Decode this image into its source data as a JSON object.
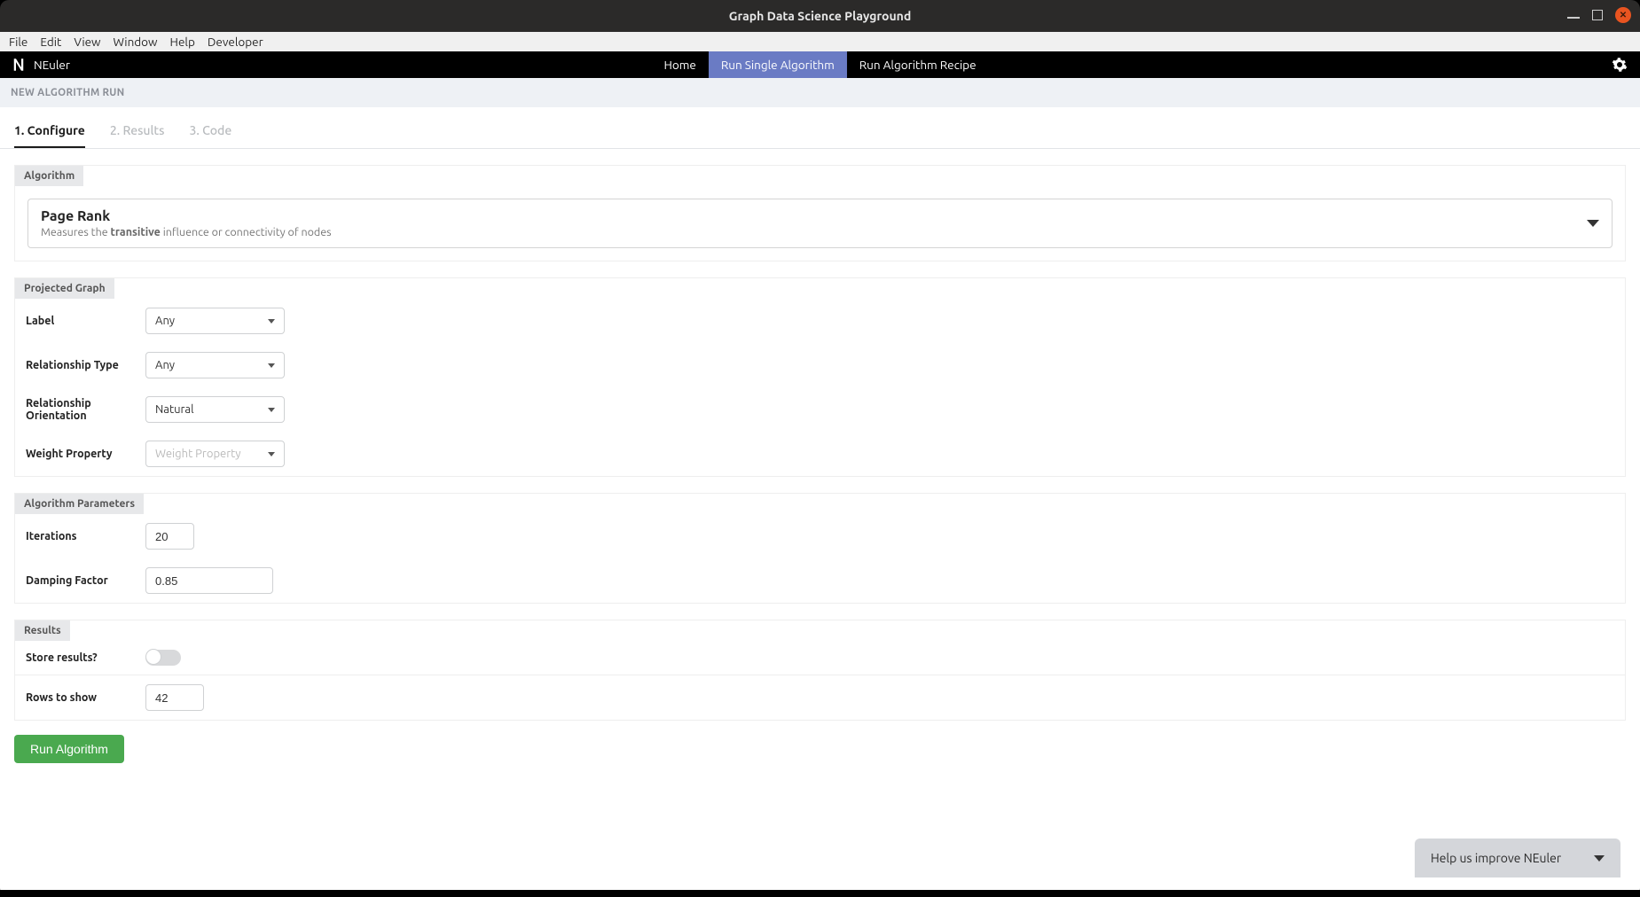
{
  "window": {
    "title": "Graph Data Science Playground"
  },
  "menubar": {
    "items": [
      "File",
      "Edit",
      "View",
      "Window",
      "Help",
      "Developer"
    ]
  },
  "appnav": {
    "brand": "NEuler",
    "items": [
      "Home",
      "Run Single Algorithm",
      "Run Algorithm Recipe"
    ],
    "active_index": 1
  },
  "banner": "NEW ALGORITHM RUN",
  "steps": {
    "items": [
      "1. Configure",
      "2. Results",
      "3. Code"
    ],
    "active_index": 0
  },
  "algorithm_section": {
    "header": "Algorithm",
    "selected": {
      "name": "Page Rank",
      "desc_pre": "Measures the ",
      "desc_strong": "transitive",
      "desc_post": " influence or connectivity of nodes"
    }
  },
  "projected_graph": {
    "header": "Projected Graph",
    "fields": {
      "label": {
        "label": "Label",
        "value": "Any"
      },
      "rel_type": {
        "label": "Relationship Type",
        "value": "Any"
      },
      "rel_orientation": {
        "label": "Relationship Orientation",
        "value": "Natural"
      },
      "weight_property": {
        "label": "Weight Property",
        "placeholder": "Weight Property"
      }
    }
  },
  "algo_params": {
    "header": "Algorithm Parameters",
    "iterations": {
      "label": "Iterations",
      "value": "20"
    },
    "damping": {
      "label": "Damping Factor",
      "value": "0.85"
    }
  },
  "results_section": {
    "header": "Results",
    "store": {
      "label": "Store results?",
      "value": false
    },
    "rows": {
      "label": "Rows to show",
      "value": "42"
    }
  },
  "run_button": "Run Algorithm",
  "feedback": "Help us improve NEuler"
}
